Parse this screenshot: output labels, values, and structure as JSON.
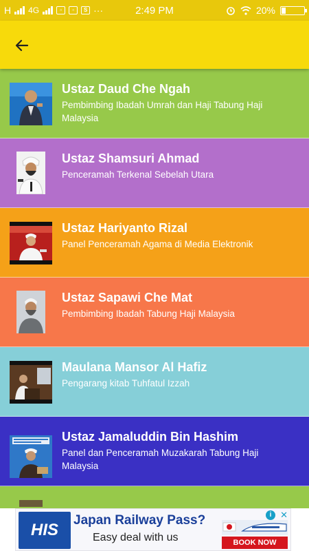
{
  "status_bar": {
    "carrier": "H",
    "network": "4G",
    "time": "2:49 PM",
    "battery": "20%",
    "indicators": [
      "signal-icon",
      "gallery-icon",
      "gallery-icon",
      "s-icon",
      "more-dots-icon",
      "alarm-icon",
      "wifi-icon",
      "battery-icon"
    ]
  },
  "app_bar": {
    "back_icon": "arrow-left-icon",
    "color": "#f7da0b"
  },
  "speakers": [
    {
      "name": "Ustaz Daud Che Ngah",
      "description": "Pembimbing Ibadah Umrah dan Haji Tabung Haji Malaysia",
      "color": "#97c94a"
    },
    {
      "name": "Ustaz Shamsuri Ahmad",
      "description": "Penceramah Terkenal Sebelah Utara",
      "color": "#b36fcb"
    },
    {
      "name": "Ustaz Hariyanto Rizal",
      "description": "Panel Penceramah Agama di Media Elektronik",
      "color": "#f5a118"
    },
    {
      "name": "Ustaz Sapawi Che Mat",
      "description": "Pembimbing Ibadah Tabung Haji Malaysia",
      "color": "#f7774a"
    },
    {
      "name": "Maulana Mansor Al Hafiz",
      "description": "Pengarang kitab Tuhfatul Izzah",
      "color": "#86cfd8"
    },
    {
      "name": "Ustaz Jamaluddin Bin Hashim",
      "description": "Panel dan Penceramah Muzakarah Tabung Haji Malaysia",
      "color": "#3a30c4"
    },
    {
      "name": "",
      "description": "",
      "color": "#97c94a"
    }
  ],
  "ad": {
    "logo": "HIS",
    "headline": "Japan Railway Pass?",
    "subline": "Easy deal with us",
    "cta": "BOOK NOW",
    "info_icon": "info-icon",
    "close_icon": "close-icon"
  }
}
